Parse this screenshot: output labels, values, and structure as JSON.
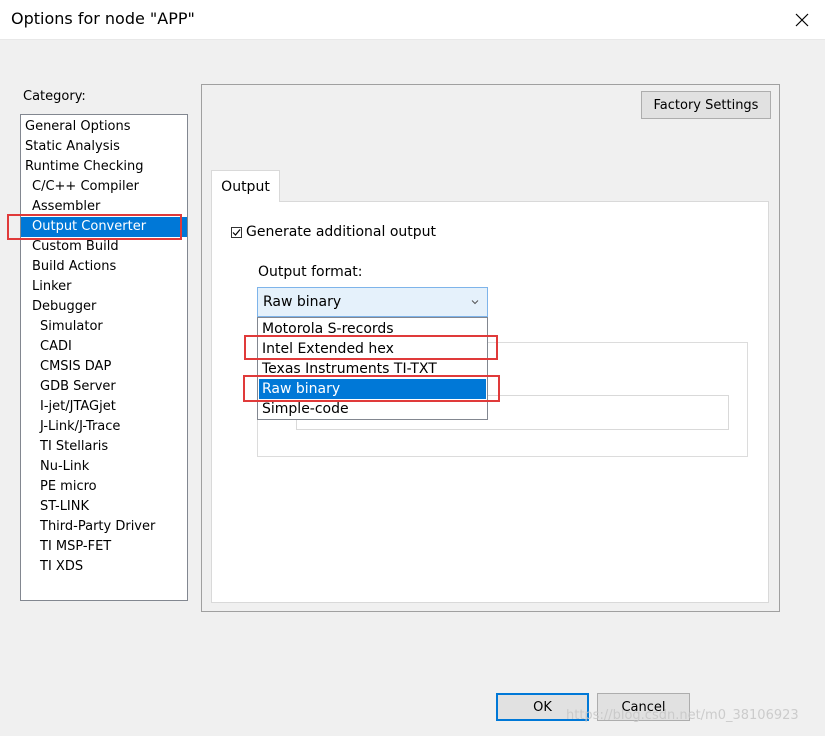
{
  "window": {
    "title": "Options for node \"APP\""
  },
  "category": {
    "label": "Category:",
    "items": [
      {
        "label": "General Options",
        "level": 0
      },
      {
        "label": "Static Analysis",
        "level": 0
      },
      {
        "label": "Runtime Checking",
        "level": 0
      },
      {
        "label": "C/C++ Compiler",
        "level": 1
      },
      {
        "label": "Assembler",
        "level": 1
      },
      {
        "label": "Output Converter",
        "level": 1,
        "selected": true
      },
      {
        "label": "Custom Build",
        "level": 1
      },
      {
        "label": "Build Actions",
        "level": 1
      },
      {
        "label": "Linker",
        "level": 1
      },
      {
        "label": "Debugger",
        "level": 1
      },
      {
        "label": "Simulator",
        "level": 2
      },
      {
        "label": "CADI",
        "level": 2
      },
      {
        "label": "CMSIS DAP",
        "level": 2
      },
      {
        "label": "GDB Server",
        "level": 2
      },
      {
        "label": "I-jet/JTAGjet",
        "level": 2
      },
      {
        "label": "J-Link/J-Trace",
        "level": 2
      },
      {
        "label": "TI Stellaris",
        "level": 2
      },
      {
        "label": "Nu-Link",
        "level": 2
      },
      {
        "label": "PE micro",
        "level": 2
      },
      {
        "label": "ST-LINK",
        "level": 2
      },
      {
        "label": "Third-Party Driver",
        "level": 2
      },
      {
        "label": "TI MSP-FET",
        "level": 2
      },
      {
        "label": "TI XDS",
        "level": 2
      }
    ]
  },
  "main": {
    "factory_settings_label": "Factory Settings",
    "tab_label": "Output",
    "generate_output": {
      "label": "Generate additional output",
      "checked": true
    },
    "output_format": {
      "label": "Output format:",
      "selected": "Raw binary",
      "options": [
        {
          "label": "Motorola S-records"
        },
        {
          "label": "Intel Extended hex"
        },
        {
          "label": "Texas Instruments TI-TXT"
        },
        {
          "label": "Raw binary",
          "selected": true
        },
        {
          "label": "Simple-code"
        }
      ]
    }
  },
  "buttons": {
    "ok_label": "OK",
    "cancel_label": "Cancel"
  },
  "watermark": "https://blog.csdn.net/m0_38106923",
  "colors": {
    "accent": "#0078d7",
    "highlight_box": "#e03a3a",
    "background": "#f0f0f0"
  }
}
